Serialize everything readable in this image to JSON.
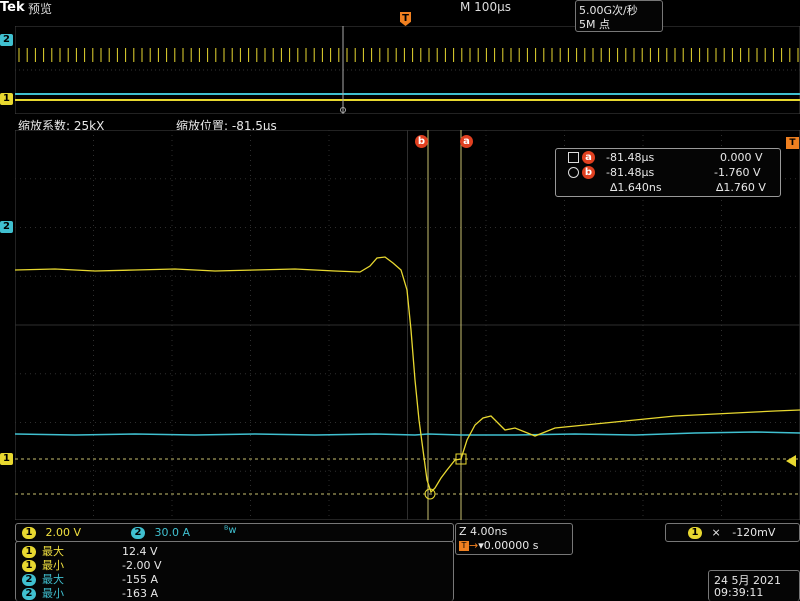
{
  "header": {
    "brand": "Tek",
    "mode": "预览",
    "timebase": "M 100µs",
    "trigger_marker": "T"
  },
  "zoom": {
    "factor_label": "缩放系数: 25kX",
    "position_label": "缩放位置: -81.5µs"
  },
  "channel_markers": {
    "ch1": "1",
    "ch2": "2",
    "trigger": "T"
  },
  "cursors": {
    "a_label": "a",
    "b_label": "b",
    "readout": {
      "a_time": "-81.48µs",
      "a_value": "0.000 V",
      "b_time": "-81.48µs",
      "b_value": "-1.760 V",
      "delta_time": "∆1.640ns",
      "delta_value": "∆1.760 V"
    }
  },
  "channels": {
    "ch1_scale": "2.00 V",
    "ch2_scale": "30.0 A",
    "bw_symbol": "ᴮw"
  },
  "measurements": [
    {
      "channel": "1",
      "label": "最大",
      "value": "12.4 V",
      "color": "yellow"
    },
    {
      "channel": "1",
      "label": "最小",
      "value": "-2.00 V",
      "color": "yellow"
    },
    {
      "channel": "2",
      "label": "最大",
      "value": "-155 A",
      "color": "cyan"
    },
    {
      "channel": "2",
      "label": "最小",
      "value": "-163 A",
      "color": "cyan"
    }
  ],
  "horizontal": {
    "zoom_scale": "Z 4.00ns",
    "trigger_delay": "▾0.00000 s",
    "sample_rate": "5.00G次/秒",
    "record_length": "5M 点"
  },
  "trigger": {
    "channel": "1",
    "slope": "⨯",
    "level": "-120mV"
  },
  "datetime": {
    "date": "24 5月  2021",
    "time": "09:39:11"
  },
  "colors": {
    "ch1": "#e8d830",
    "ch2": "#40c0d0",
    "cursor": "#e04020",
    "grid": "#3a3a3a"
  }
}
